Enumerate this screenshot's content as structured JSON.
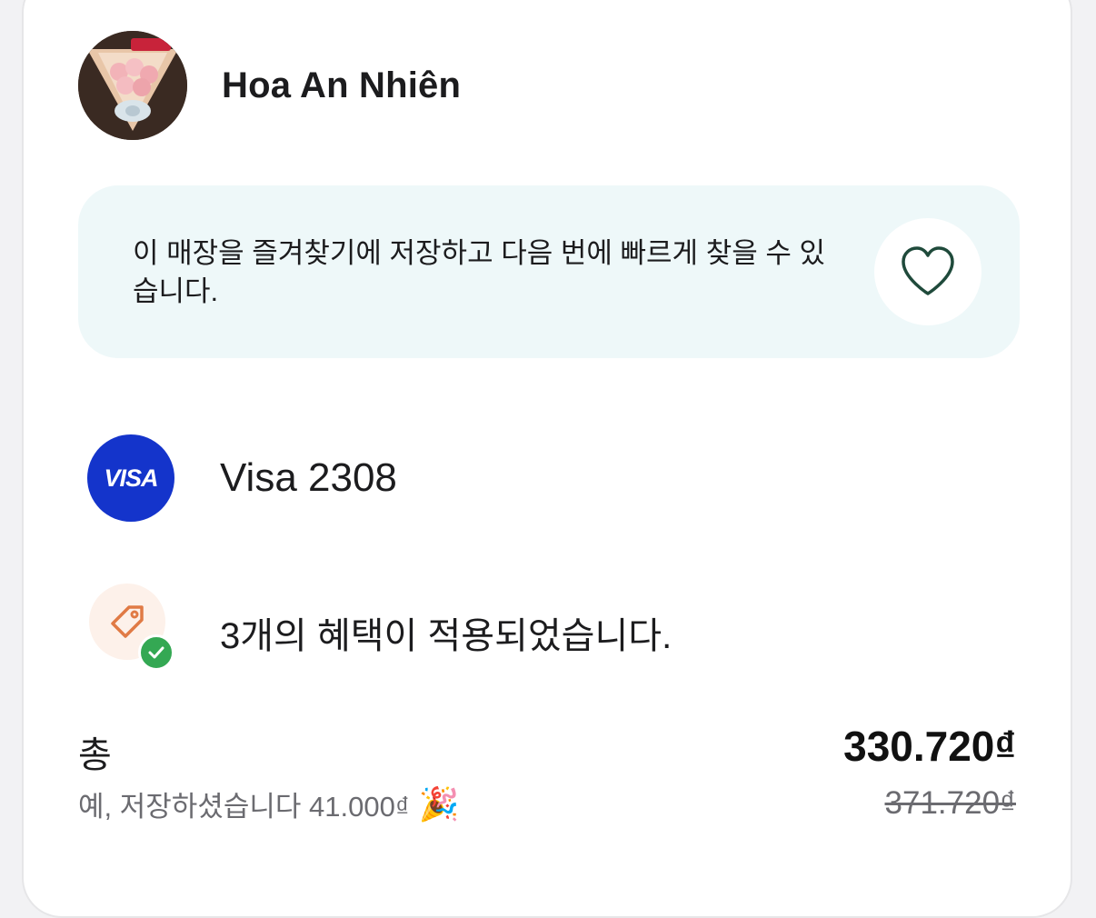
{
  "store": {
    "name": "Hoa An Nhiên"
  },
  "favorite": {
    "message": "이 매장을 즐겨찾기에 저장하고 다음 번에 빠르게 찾을 수 있습니다.",
    "icon": "heart-icon"
  },
  "payment": {
    "brand": "VISA",
    "label": "Visa 2308",
    "brand_color": "#1434cb"
  },
  "promotions": {
    "label": "3개의 혜택이 적용되었습니다.",
    "icon": "tag-icon",
    "status_icon": "check-icon",
    "status_color": "#34a853"
  },
  "summary": {
    "total_label": "총",
    "total_price": "330.720₫",
    "original_price": "371.720₫",
    "savings_text": "예, 저장하셨습니다 41.000₫",
    "savings_emoji": "🎉"
  }
}
